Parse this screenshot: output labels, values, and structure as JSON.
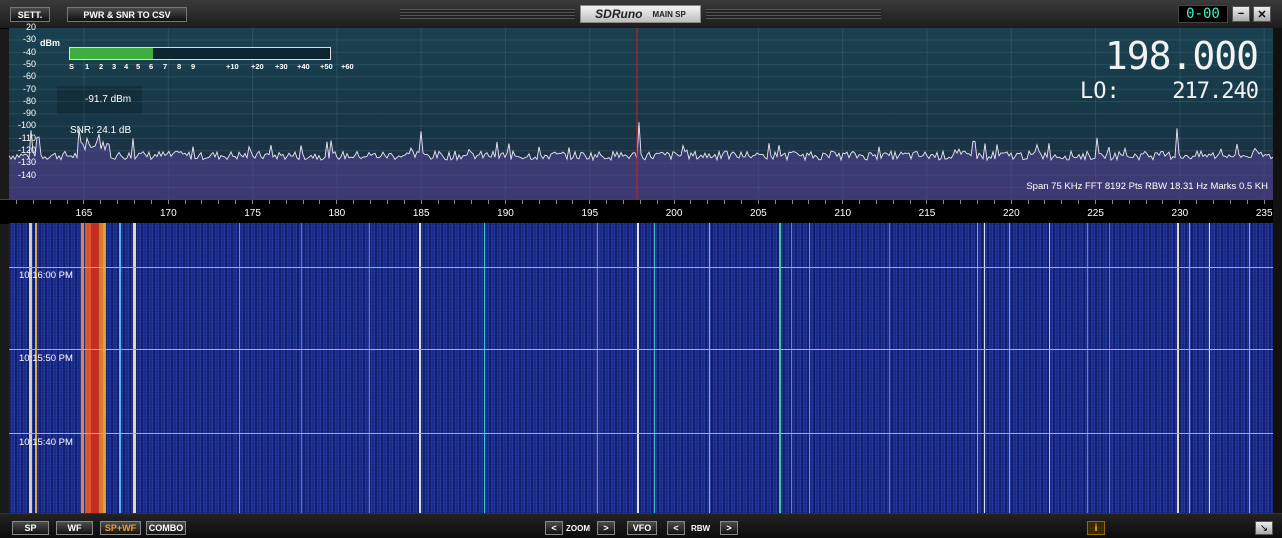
{
  "toolbar": {
    "settings_label": "SETT.",
    "csv_label": "PWR & SNR TO CSV",
    "app_name": "SDRuno",
    "window_name": "MAIN SP",
    "clock": "0-00",
    "minimize": "−",
    "close": "✕"
  },
  "spectrum": {
    "unit": "dBm",
    "y_ticks": [
      "20",
      "-30",
      "-40",
      "-50",
      "-60",
      "-70",
      "-80",
      "-90",
      "-100",
      "-110",
      "-120",
      "-130",
      "-140"
    ],
    "smeter_scale": [
      "S",
      "1",
      "2",
      "3",
      "4",
      "5",
      "6",
      "7",
      "8",
      "9",
      "+10",
      "+20",
      "+30",
      "+40",
      "+50",
      "+60"
    ],
    "smeter_level_fraction": 0.32,
    "power": "-91.7 dBm",
    "snr": "SNR: 24.1 dB",
    "frequency": "198.000",
    "lo_label": "LO:",
    "lo_value": "217.240",
    "info": "Span 75 KHz   FFT 8192 Pts   RBW 18.31 Hz   Marks 0.5 KH"
  },
  "freq_axis": {
    "labels": [
      "165",
      "170",
      "175",
      "180",
      "185",
      "190",
      "195",
      "200",
      "205",
      "210",
      "215",
      "220",
      "225",
      "230",
      "235"
    ]
  },
  "waterfall": {
    "time_labels": [
      "10:16:00 PM",
      "10:15:50 PM",
      "10:15:40 PM"
    ]
  },
  "bottom": {
    "sp": "SP",
    "wf": "WF",
    "spwf": "SP+WF",
    "combo": "COMBO",
    "zoom_label": "ZOOM",
    "vfo": "VFO",
    "rbw_label": "RBW",
    "prev": "<",
    "next": ">",
    "info": "i",
    "resize": "↘"
  },
  "colors": {
    "accent_orange": "#f39a2a",
    "smeter_green": "#3fae3f",
    "cursor_red": "#c02020",
    "clock_cyan": "#3ff0c8"
  }
}
